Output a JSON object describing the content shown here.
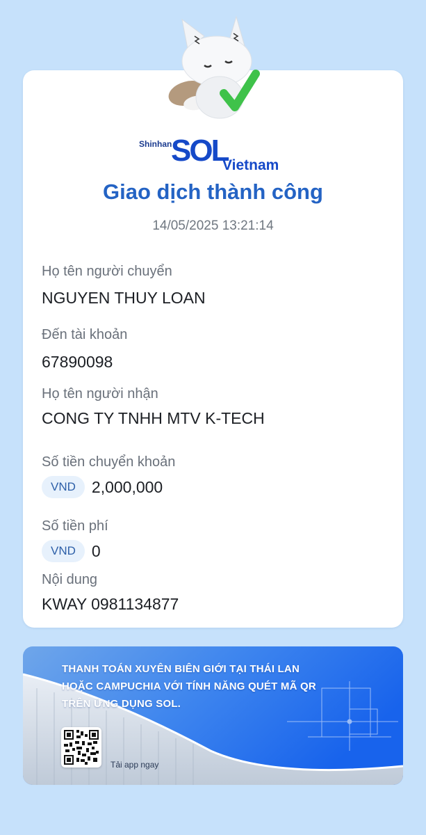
{
  "brand": {
    "shinhan": "Shinhan",
    "sol": "SOL",
    "vietnam": "Vietnam"
  },
  "receipt": {
    "title": "Giao dịch thành công",
    "datetime": "14/05/2025 13:21:14",
    "sender_label": "Họ tên người chuyển",
    "sender_value": "NGUYEN THUY LOAN",
    "account_label": "Đến tài khoản",
    "account_value": "67890098",
    "receiver_label": "Họ tên người nhận",
    "receiver_value": "CONG TY TNHH MTV K-TECH",
    "amount_label": "Số tiền chuyển khoản",
    "amount_currency": "VND",
    "amount_value": "2,000,000",
    "fee_label": "Số tiền phí",
    "fee_currency": "VND",
    "fee_value": "0",
    "content_label": "Nội dung",
    "content_value": "KWAY 0981134877"
  },
  "banner": {
    "line1": "THANH TOÁN XUYÊN BIÊN GIỚI TẠI THÁI LAN",
    "line2": "HOẶC CAMPUCHIA VỚI TÍNH NĂNG QUÉT MÃ QR",
    "line3": "TRÊN ỨNG DỤNG SOL.",
    "cta": "Tải app ngay"
  },
  "icons": {
    "mascot": "fox-mascot-with-checkmark-icon",
    "qr": "qr-code-icon"
  },
  "colors": {
    "background": "#c6e1fb",
    "accent": "#2463c4",
    "brand_blue": "#1549c8",
    "check_green": "#3fc24a"
  }
}
